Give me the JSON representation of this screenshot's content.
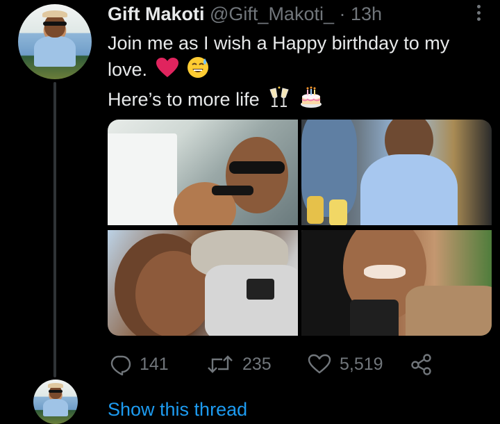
{
  "tweet": {
    "author_name": "Gift Makoti",
    "handle": "@Gift_Makoti_",
    "separator": "·",
    "time": "13h",
    "text_line1": "Join me as I wish a Happy birthday to my",
    "text_line2": "love.",
    "text_line2_emojis": [
      "red-heart-emoji",
      "sweat-smile-emoji"
    ],
    "text_line3": "Here’s to more life",
    "text_line3_emojis": [
      "clinking-glasses-emoji",
      "birthday-cake-emoji"
    ],
    "photos": 4
  },
  "actions": {
    "reply_count": "141",
    "retweet_count": "235",
    "like_count": "5,519"
  },
  "thread": {
    "show_thread_label": "Show this thread"
  },
  "colors": {
    "background": "#000000",
    "primary_text": "#e7e9ea",
    "secondary_text": "#71767b",
    "link": "#1d9bf0",
    "heart": "#e0245e"
  }
}
